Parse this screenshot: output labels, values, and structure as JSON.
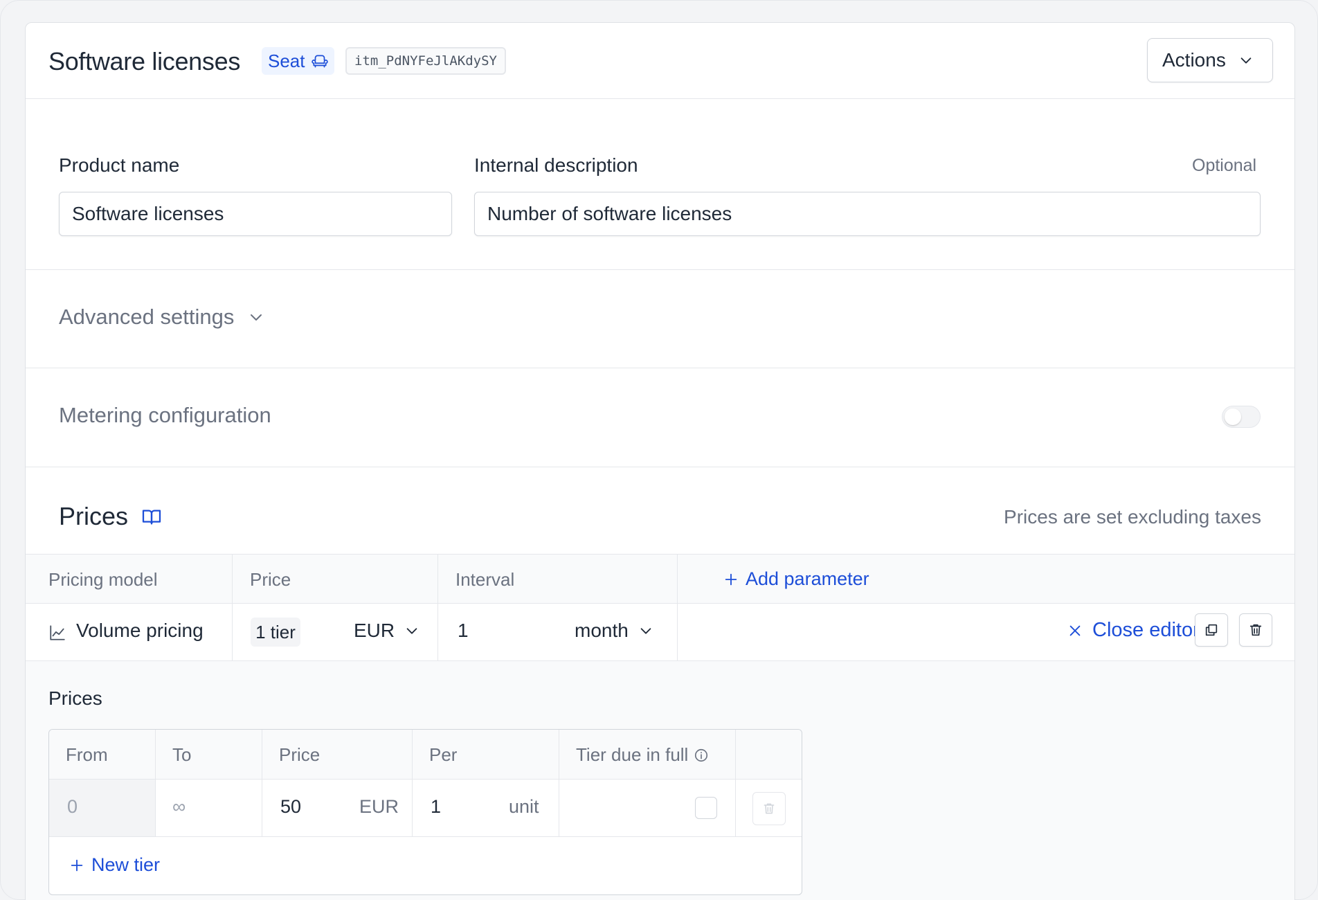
{
  "header": {
    "title": "Software licenses",
    "badge_label": "Seat",
    "item_id": "itm_PdNYFeJlAKdySY",
    "actions_label": "Actions"
  },
  "form": {
    "product_name_label": "Product name",
    "product_name_value": "Software licenses",
    "description_label": "Internal description",
    "description_optional": "Optional",
    "description_value": "Number of software licenses"
  },
  "advanced_settings": {
    "label": "Advanced settings"
  },
  "metering": {
    "label": "Metering configuration",
    "enabled": false
  },
  "prices": {
    "title": "Prices",
    "note": "Prices are set excluding taxes",
    "columns": {
      "pricing_model": "Pricing model",
      "price": "Price",
      "interval": "Interval",
      "add_parameter": "Add parameter"
    },
    "row": {
      "pricing_model": "Volume pricing",
      "tiers": "1 tier",
      "currency": "EUR",
      "interval_count": "1",
      "interval_unit": "month",
      "close_editor": "Close editor"
    }
  },
  "editor": {
    "title": "Prices",
    "columns": {
      "from": "From",
      "to": "To",
      "price": "Price",
      "per": "Per",
      "tier_due": "Tier due in full"
    },
    "tiers": [
      {
        "from": "0",
        "to": "∞",
        "price": "50",
        "currency": "EUR",
        "per": "1",
        "per_unit": "unit",
        "due_in_full": false
      }
    ],
    "new_tier_label": "New tier"
  },
  "colors": {
    "accent": "#1d4ed8",
    "border": "#e5e7eb",
    "muted_text": "#6b7280"
  }
}
